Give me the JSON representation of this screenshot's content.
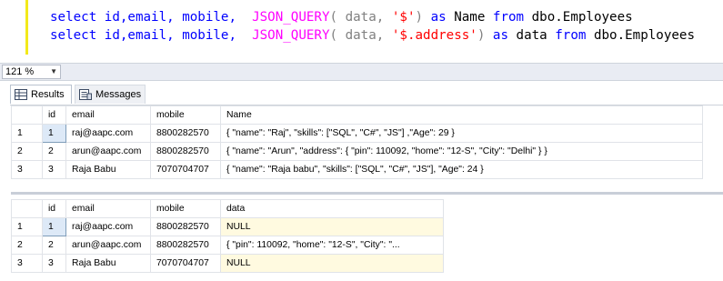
{
  "editor": {
    "line1": {
      "p1": "select id,email, mobile,  ",
      "p2": "JSON_QUERY",
      "p3": "( data, ",
      "p4": "'$'",
      "p5": ") ",
      "p6": "as",
      "p7": " Name ",
      "p8": "from",
      "p9": " dbo.Employees"
    },
    "line2": {
      "p1": "select id,email, mobile,  ",
      "p2": "JSON_QUERY",
      "p3": "( data, ",
      "p4": "'$.address'",
      "p5": ") ",
      "p6": "as",
      "p7": " data ",
      "p8": "from",
      "p9": " dbo.Employees"
    }
  },
  "zoom": {
    "value": "121 %"
  },
  "tabs": {
    "results": "Results",
    "messages": "Messages"
  },
  "grid1": {
    "columns": [
      "id",
      "email",
      "mobile",
      "Name"
    ],
    "rows": [
      {
        "rownum": "1",
        "id": "1",
        "email": "raj@aapc.com",
        "mobile": "8800282570",
        "value": "{     \"name\": \"Raj\",     \"skills\": [\"SQL\", \"C#\", \"JS\"]  ,\"Age\": 29  }"
      },
      {
        "rownum": "2",
        "id": "2",
        "email": "arun@aapc.com",
        "mobile": "8800282570",
        "value": "{ \"name\": \"Arun\",  \"address\":  {   \"pin\": 110092,   \"home\": \"12-S\",    \"City\": \"Delhi\"   } }"
      },
      {
        "rownum": "3",
        "id": "3",
        "email": "Raja Babu",
        "mobile": "7070704707",
        "value": "{ \"name\": \"Raja babu\", \"skills\": [\"SQL\", \"C#\", \"JS\"], \"Age\": 24 }"
      }
    ]
  },
  "grid2": {
    "columns": [
      "id",
      "email",
      "mobile",
      "data"
    ],
    "rows": [
      {
        "rownum": "1",
        "id": "1",
        "email": "raj@aapc.com",
        "mobile": "8800282570",
        "value": "NULL"
      },
      {
        "rownum": "2",
        "id": "2",
        "email": "arun@aapc.com",
        "mobile": "8800282570",
        "value": "{  \"pin\": 110092,   \"home\": \"12-S\",    \"City\": \"..."
      },
      {
        "rownum": "3",
        "id": "3",
        "email": "Raja Babu",
        "mobile": "7070704707",
        "value": "NULL"
      }
    ]
  },
  "colors": {
    "keyword": "#0000ff",
    "function": "#ff00ff",
    "string": "#ff0000",
    "selected_cell": "#dde9f7",
    "null_cell": "#fffae0"
  }
}
